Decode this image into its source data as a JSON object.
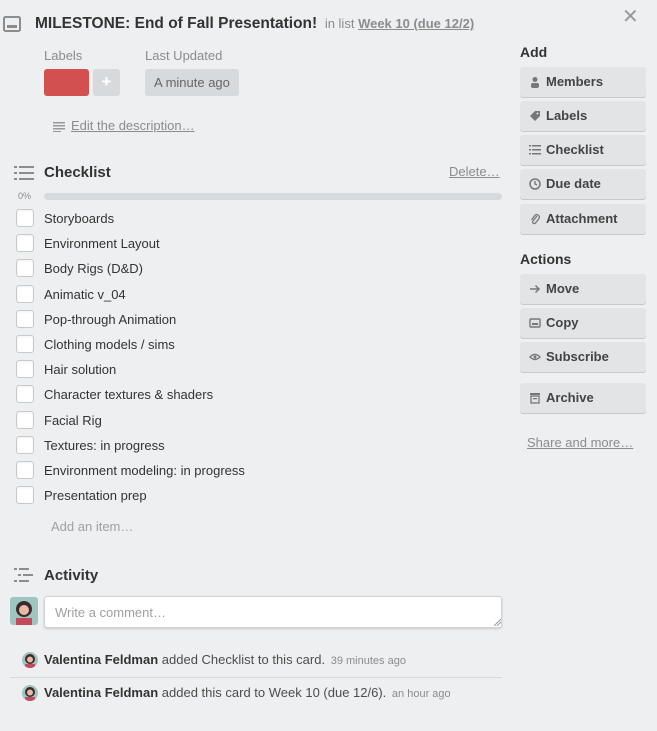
{
  "card": {
    "title": "MILESTONE: End of Fall Presentation!",
    "in_list_prefix": "in list",
    "list_name": "Week 10 (due 12/2)",
    "close_glyph": "✕"
  },
  "labels": {
    "heading": "Labels",
    "chip_color": "#d25050",
    "add_glyph": "+"
  },
  "last_updated": {
    "heading": "Last Updated",
    "value": "A minute ago"
  },
  "description": {
    "link": "Edit the description…"
  },
  "checklist": {
    "title": "Checklist",
    "delete_link": "Delete…",
    "progress_label": "0%",
    "progress_fraction": 0,
    "items": [
      "Storyboards",
      "Environment Layout",
      "Body Rigs (D&D)",
      "Animatic v_04",
      "Pop-through Animation",
      "Clothing models / sims",
      "Hair solution",
      "Character textures & shaders",
      "Facial Rig",
      "Textures: in progress",
      "Environment modeling: in progress",
      "Presentation prep"
    ],
    "add_item_placeholder": "Add an item…"
  },
  "activity": {
    "title": "Activity",
    "comment_placeholder": "Write a comment…",
    "entries": [
      {
        "user": "Valentina Feldman",
        "text": "added Checklist to this card.",
        "when": "39 minutes ago"
      },
      {
        "user": "Valentina Feldman",
        "text": "added this card to Week 10 (due 12/6).",
        "when": "an hour ago"
      }
    ]
  },
  "sidebar": {
    "add_heading": "Add",
    "add_buttons": [
      {
        "label": "Members",
        "icon": "person-icon"
      },
      {
        "label": "Labels",
        "icon": "tag-icon"
      },
      {
        "label": "Checklist",
        "icon": "checklist-icon"
      },
      {
        "label": "Due date",
        "icon": "clock-icon"
      },
      {
        "label": "Attachment",
        "icon": "paperclip-icon"
      }
    ],
    "actions_heading": "Actions",
    "action_buttons": [
      {
        "label": "Move",
        "icon": "arrow-right-icon"
      },
      {
        "label": "Copy",
        "icon": "card-icon"
      },
      {
        "label": "Subscribe",
        "icon": "eye-icon"
      },
      {
        "label": "Archive",
        "icon": "archive-icon"
      }
    ],
    "share_link": "Share and more…"
  },
  "colors": {
    "background": "#edeff0",
    "label_red": "#d25050",
    "button_bg": "#e2e4e6",
    "progress_track": "#d6dadc"
  }
}
